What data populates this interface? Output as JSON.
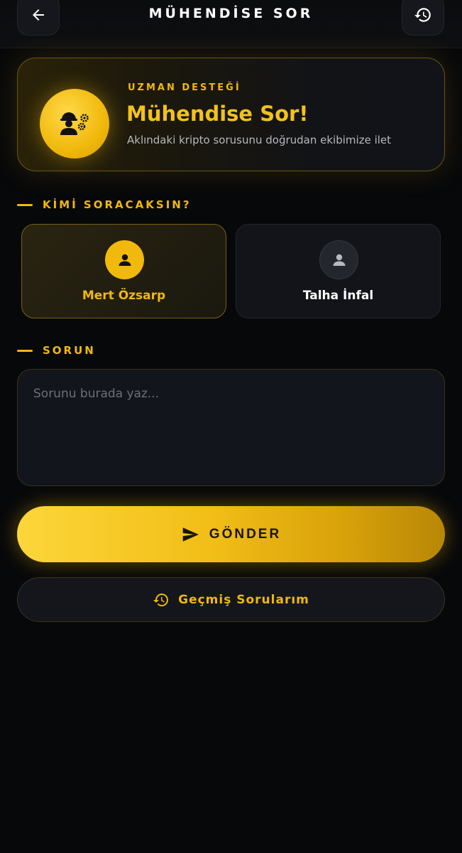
{
  "header": {
    "title": "MÜHENDİSE SOR",
    "back_icon": "arrow-left-icon",
    "history_icon": "history-icon"
  },
  "hero": {
    "eyebrow": "UZMAN DESTEĞİ",
    "title": "Mühendise Sor!",
    "subtitle": "Aklındaki kripto sorusunu doğrudan ekibimize ilet",
    "icon": "engineer-gears-icon"
  },
  "recipient_section": {
    "label": "KİMİ SORACAKSIN?",
    "options": [
      {
        "name": "Mert Özsarp",
        "selected": true,
        "icon": "person-icon"
      },
      {
        "name": "Talha İnfal",
        "selected": false,
        "icon": "person-icon"
      }
    ]
  },
  "question_section": {
    "label": "SORUN",
    "placeholder": "Sorunu burada yaz...",
    "value": ""
  },
  "actions": {
    "send_label": "GÖNDER",
    "send_icon": "send-icon",
    "history_label": "Geçmiş Sorularım",
    "history_icon": "history-icon"
  },
  "colors": {
    "accent": "#f0b90b",
    "background": "#07080a",
    "card": "#13151c"
  }
}
